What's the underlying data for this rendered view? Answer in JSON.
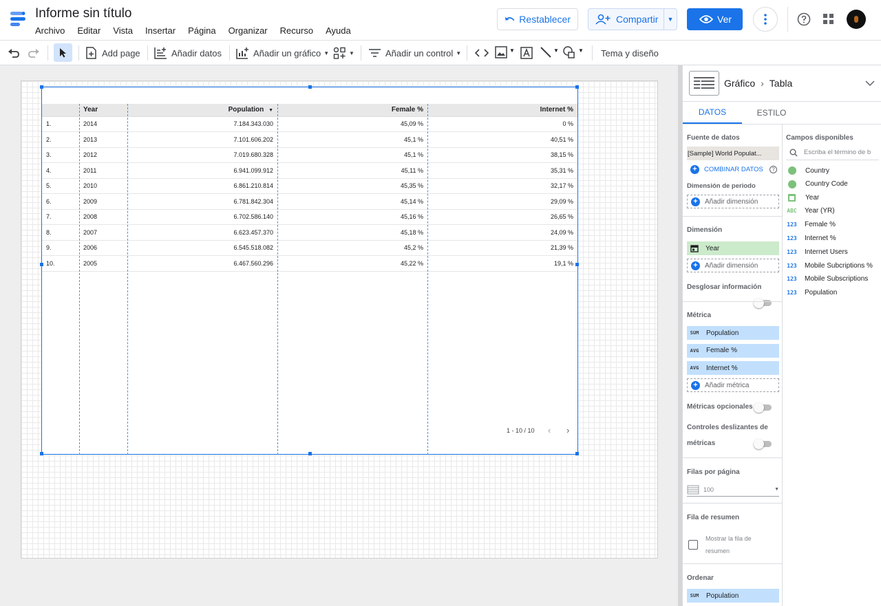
{
  "app": {
    "title": "Informe sin título",
    "menu": [
      "Archivo",
      "Editar",
      "Vista",
      "Insertar",
      "Página",
      "Organizar",
      "Recurso",
      "Ayuda"
    ]
  },
  "header": {
    "reset_label": "Restablecer",
    "share_label": "Compartir",
    "view_label": "Ver"
  },
  "toolbar": {
    "add_page": "Add page",
    "add_data": "Añadir datos",
    "add_chart": "Añadir un gráfico",
    "add_control": "Añadir un control",
    "theme": "Tema y diseño"
  },
  "table": {
    "columns": [
      "Year",
      "Population",
      "Female %",
      "Internet %"
    ],
    "sort_column": "Population",
    "rows": [
      [
        "1.",
        "2014",
        "7.184.343.030",
        "45,09 %",
        "0 %"
      ],
      [
        "2.",
        "2013",
        "7.101.606.202",
        "45,1 %",
        "40,51 %"
      ],
      [
        "3.",
        "2012",
        "7.019.680.328",
        "45,1 %",
        "38,15 %"
      ],
      [
        "4.",
        "2011",
        "6.941.099.912",
        "45,11 %",
        "35,31 %"
      ],
      [
        "5.",
        "2010",
        "6.861.210.814",
        "45,35 %",
        "32,17 %"
      ],
      [
        "6.",
        "2009",
        "6.781.842.304",
        "45,14 %",
        "29,09 %"
      ],
      [
        "7.",
        "2008",
        "6.702.586.140",
        "45,16 %",
        "26,65 %"
      ],
      [
        "8.",
        "2007",
        "6.623.457.370",
        "45,18 %",
        "24,09 %"
      ],
      [
        "9.",
        "2006",
        "6.545.518.082",
        "45,2 %",
        "21,39 %"
      ],
      [
        "10.",
        "2005",
        "6.467.560.296",
        "45,22 %",
        "19,1 %"
      ]
    ],
    "pagination": "1 - 10 / 10"
  },
  "panel": {
    "breadcrumb_parent": "Gráfico",
    "breadcrumb_child": "Tabla",
    "tab_data": "DATOS",
    "tab_style": "ESTILO",
    "data_source_label": "Fuente de datos",
    "data_source": "[Sample] World Populat...",
    "blend_label": "COMBINAR DATOS",
    "period_dim_label": "Dimensión de periodo",
    "add_dimension": "Añadir dimensión",
    "dimension_label": "Dimensión",
    "dimension_value": "Year",
    "drill_label": "Desglosar información",
    "metric_label": "Métrica",
    "metrics": [
      {
        "agg": "SUM",
        "name": "Population"
      },
      {
        "agg": "AVG",
        "name": "Female %"
      },
      {
        "agg": "AVG",
        "name": "Internet %"
      }
    ],
    "add_metric": "Añadir métrica",
    "optional_metrics": "Métricas opcionales",
    "metric_sliders_1": "Controles deslizantes de",
    "metric_sliders_2": "métricas",
    "rows_per_page_label": "Filas por página",
    "rows_per_page": "100",
    "summary_label": "Fila de resumen",
    "summary_check_1": "Mostrar la fila de",
    "summary_check_2": "resumen",
    "sort_label": "Ordenar",
    "sort_agg": "SUM",
    "sort_value": "Population",
    "fields_label": "Campos disponibles",
    "search_placeholder": "Escriba el término de b",
    "fields": [
      {
        "type": "geo",
        "name": "Country"
      },
      {
        "type": "geo",
        "name": "Country Code"
      },
      {
        "type": "date",
        "name": "Year"
      },
      {
        "type": "ABC",
        "name": "Year (YR)"
      },
      {
        "type": "123",
        "name": "Female %"
      },
      {
        "type": "123",
        "name": "Internet %"
      },
      {
        "type": "123",
        "name": "Internet Users"
      },
      {
        "type": "123",
        "name": "Mobile Subcriptions %"
      },
      {
        "type": "123",
        "name": "Mobile Subscriptions"
      },
      {
        "type": "123",
        "name": "Population"
      }
    ]
  }
}
